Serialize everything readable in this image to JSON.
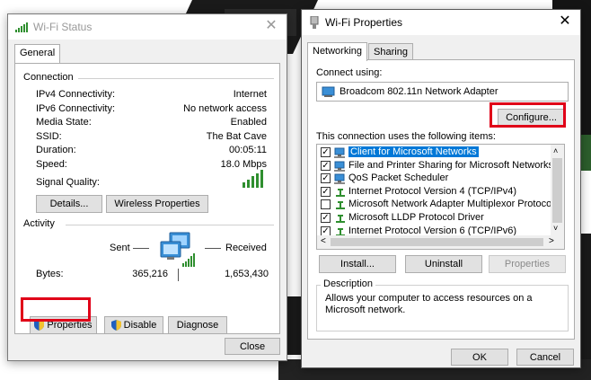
{
  "status_window": {
    "title": "Wi-Fi Status",
    "tab": "General",
    "connection_label": "Connection",
    "rows": [
      {
        "label": "IPv4 Connectivity:",
        "value": "Internet"
      },
      {
        "label": "IPv6 Connectivity:",
        "value": "No network access"
      },
      {
        "label": "Media State:",
        "value": "Enabled"
      },
      {
        "label": "SSID:",
        "value": "The Bat Cave"
      },
      {
        "label": "Duration:",
        "value": "00:05:11"
      },
      {
        "label": "Speed:",
        "value": "18.0 Mbps"
      }
    ],
    "signal_label": "Signal Quality:",
    "details_button": "Details...",
    "wireless_button": "Wireless Properties",
    "activity_label": "Activity",
    "sent_label": "Sent",
    "received_label": "Received",
    "bytes_label": "Bytes:",
    "bytes_sent": "365,216",
    "bytes_received": "1,653,430",
    "properties_button": "Properties",
    "disable_button": "Disable",
    "diagnose_button": "Diagnose",
    "close_button": "Close"
  },
  "props_window": {
    "title": "Wi-Fi Properties",
    "tabs": [
      "Networking",
      "Sharing"
    ],
    "connect_using_label": "Connect using:",
    "adapter": "Broadcom 802.11n Network Adapter",
    "configure_button": "Configure...",
    "items_label": "This connection uses the following items:",
    "items": [
      {
        "label": "Client for Microsoft Networks",
        "checked": true
      },
      {
        "label": "File and Printer Sharing for Microsoft Networks",
        "checked": true
      },
      {
        "label": "QoS Packet Scheduler",
        "checked": true
      },
      {
        "label": "Internet Protocol Version 4 (TCP/IPv4)",
        "checked": true
      },
      {
        "label": "Microsoft Network Adapter Multiplexor Protocol",
        "checked": false
      },
      {
        "label": "Microsoft LLDP Protocol Driver",
        "checked": true
      },
      {
        "label": "Internet Protocol Version 6 (TCP/IPv6)",
        "checked": true
      }
    ],
    "install_button": "Install...",
    "uninstall_button": "Uninstall",
    "properties_button": "Properties",
    "description_label": "Description",
    "description": "Allows your computer to access resources on a Microsoft network.",
    "ok_button": "OK",
    "cancel_button": "Cancel"
  },
  "colors": {
    "highlight": "#e00018",
    "selection": "#0078d7",
    "props_titlebar": "#ffffff",
    "signal": "#2f8f2f"
  }
}
